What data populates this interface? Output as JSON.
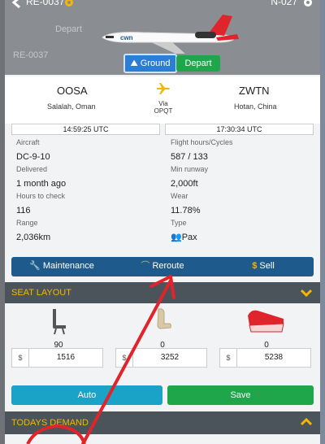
{
  "header": {
    "left_title": "RE-0037",
    "right_title": "N-027",
    "ghost_depart": "Depart",
    "ghost_code": "RE-0037"
  },
  "status_buttons": {
    "ground": "Ground",
    "depart": "Depart"
  },
  "route": {
    "from_code": "OOSA",
    "from_city": "Salalah, Oman",
    "via_label": "Via",
    "via_code": "OPQT",
    "to_code": "ZWTN",
    "to_city": "Hotan, China",
    "depart_time": "14:59:25 UTC",
    "arrive_time": "17:30:34 UTC"
  },
  "details": {
    "left": [
      {
        "label": "Aircraft",
        "value": "DC-9-10"
      },
      {
        "label": "Delivered",
        "value": "1 month ago"
      },
      {
        "label": "Hours to check",
        "value": "116"
      },
      {
        "label": "Range",
        "value": "2,036km"
      }
    ],
    "right": [
      {
        "label": "Flight hours/Cycles",
        "value": "587 / 133"
      },
      {
        "label": "Min runway",
        "value": "2,000ft"
      },
      {
        "label": "Wear",
        "value": "11.78%"
      },
      {
        "label": "Type",
        "value": "Pax"
      }
    ]
  },
  "actions": {
    "maintenance": "Maintenance",
    "reroute": "Reroute",
    "sell": "Sell"
  },
  "seat_layout": {
    "title": "SEAT LAYOUT",
    "classes": [
      {
        "count": "90",
        "currency": "$",
        "price": "1516"
      },
      {
        "count": "0",
        "currency": "$",
        "price": "3252"
      },
      {
        "count": "0",
        "currency": "$",
        "price": "5238"
      }
    ],
    "auto_label": "Auto",
    "save_label": "Save"
  },
  "demand": {
    "title": "TODAYS DEMAND"
  },
  "colors": {
    "primary": "#1e5a8c",
    "accent": "#f2b705",
    "green": "#1fa64a",
    "cyan": "#1aa3c6",
    "annotation": "#e0242b"
  },
  "icons": [
    "back-chevron-icon",
    "gear-icon",
    "airplane-icon",
    "wrench-icon",
    "reroute-icon",
    "dollar-icon",
    "chevron-down-icon",
    "chevron-up-icon",
    "economy-seat-icon",
    "business-seat-icon",
    "first-class-seat-icon",
    "people-icon"
  ]
}
